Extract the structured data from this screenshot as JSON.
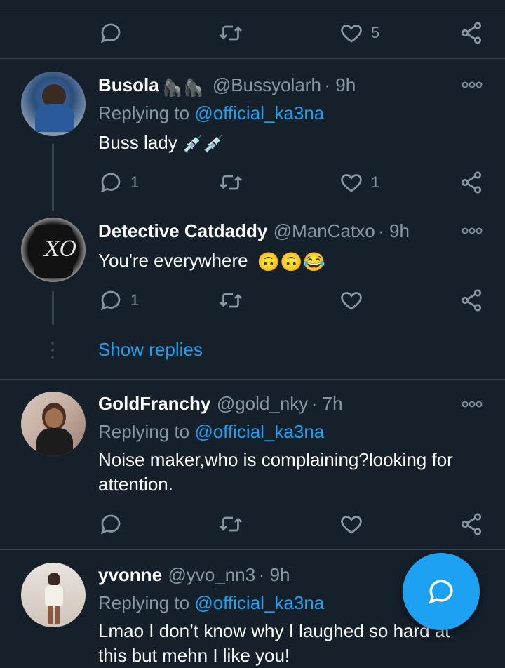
{
  "top_actions": {
    "like_count": "5"
  },
  "tweets": [
    {
      "name": "Busola",
      "name_emoji": "🦍🦍",
      "handle": "@Bussyolarh",
      "time": "· 9h",
      "replying_prefix": "Replying to ",
      "replying_to": "@official_ka3na",
      "text": "Buss lady",
      "text_emoji": "💉💉",
      "reply_count": "1",
      "like_count": "1"
    },
    {
      "name": "Detective Catdaddy",
      "handle": "@ManCatxo",
      "time": "· 9h",
      "text": "You're everywhere",
      "text_emoji": "🙃🙃😂",
      "reply_count": "1",
      "like_count": ""
    },
    {
      "name": "GoldFranchy",
      "handle": "@gold_nky",
      "time": "· 7h",
      "replying_prefix": "Replying to ",
      "replying_to": "@official_ka3na",
      "text_line1": "Noise maker,who is complaining?looking for",
      "text_line2": "attention.",
      "reply_count": "",
      "like_count": ""
    },
    {
      "name": "yvonne",
      "handle": "@yvo_nn3",
      "time": "· 9h",
      "replying_prefix": "Replying to ",
      "replying_to": "@official_ka3na",
      "text_line1": "Lmao I don’t know why I laughed so hard at",
      "text_line2": "this but mehn I like you!"
    }
  ],
  "show_replies": "Show replies",
  "colors": {
    "bg": "#15202b",
    "accent": "#1da1f2",
    "muted": "#8899a6",
    "divider": "#38444d"
  }
}
